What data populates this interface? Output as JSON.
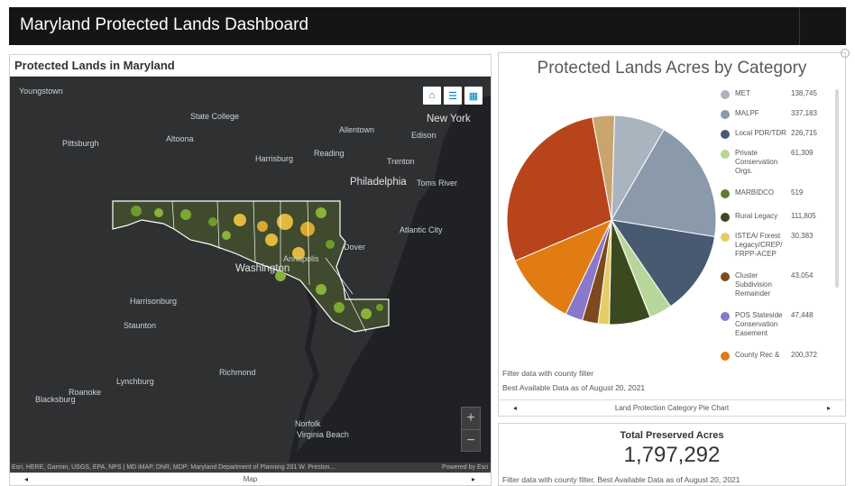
{
  "header": {
    "title": "Maryland Protected Lands Dashboard"
  },
  "map": {
    "title": "Protected Lands in Maryland",
    "cities": [
      "Youngstown",
      "State College",
      "New York",
      "Pittsburgh",
      "Altoona",
      "Allentown",
      "Edison",
      "Harrisburg",
      "Reading",
      "Trenton",
      "Philadelphia",
      "Toms River",
      "Atlantic City",
      "Dover",
      "Washington",
      "Annapolis",
      "Harrisonburg",
      "Staunton",
      "Richmond",
      "Lynchburg",
      "Roanoke",
      "Blacksburg",
      "Norfolk",
      "Virginia Beach"
    ],
    "tools": {
      "home": "home-icon",
      "legend": "legend-icon",
      "basemap": "basemap-icon"
    },
    "zoom_in": "+",
    "zoom_out": "−",
    "attribution": "Esri, HERE, Garmin, USGS, EPA, NPS | MD iMAP, DNR, MDP: Maryland Department of Planning 201 W. Preston...",
    "powered_by": "Powered by Esri",
    "footer_label": "Map",
    "prev_arrow": "◂",
    "next_arrow": "▸"
  },
  "chart_panel": {
    "filter_note": "Filter data with county filter",
    "data_note": "Best Available Data as of August 20, 2021",
    "footer_label": "Land Protection Category Pie Chart",
    "prev_arrow": "◂",
    "next_arrow": "▸"
  },
  "chart_data": {
    "type": "pie",
    "title": "Protected Lands Acres by Category",
    "legend_position": "right",
    "slices": [
      {
        "label": "MET",
        "value": 138745,
        "display": "138,745",
        "color": "#aab4bf"
      },
      {
        "label": "MALPF",
        "value": 337183,
        "display": "337,183",
        "color": "#8a9aab"
      },
      {
        "label": "Local PDR/TDR",
        "value": 226715,
        "display": "226,715",
        "color": "#485a72"
      },
      {
        "label": "Private Conservation Orgs.",
        "value": 61309,
        "display": "61,309",
        "color": "#b9d69a"
      },
      {
        "label": "MARBIDCO",
        "value": 519,
        "display": "519",
        "color": "#5e7d2e"
      },
      {
        "label": "Rural Legacy",
        "value": 111805,
        "display": "111,805",
        "color": "#3a4a1e"
      },
      {
        "label": "ISTEA/ Forest Legacy/CREP/ FRPP-ACEP",
        "value": 30383,
        "display": "30,383",
        "color": "#e6cc66"
      },
      {
        "label": "Cluster Subdivision Remainder",
        "value": 43054,
        "display": "43,054",
        "color": "#7d4a1e"
      },
      {
        "label": "POS Stateside Conservation Easement",
        "value": 47448,
        "display": "47,448",
        "color": "#8a78c8"
      },
      {
        "label": "County Rec &",
        "value": 200372,
        "display": "200,372",
        "color": "#e07c12"
      },
      {
        "label": "",
        "value": 500000,
        "display": "",
        "color": "#b8441c"
      },
      {
        "label": "",
        "value": 60000,
        "display": "",
        "color": "#c9a56e"
      }
    ]
  },
  "total": {
    "label": "Total Preserved Acres",
    "value": "1,797,292",
    "note": "Filter data with county filter, Best Available Data as of August 20, 2021"
  }
}
